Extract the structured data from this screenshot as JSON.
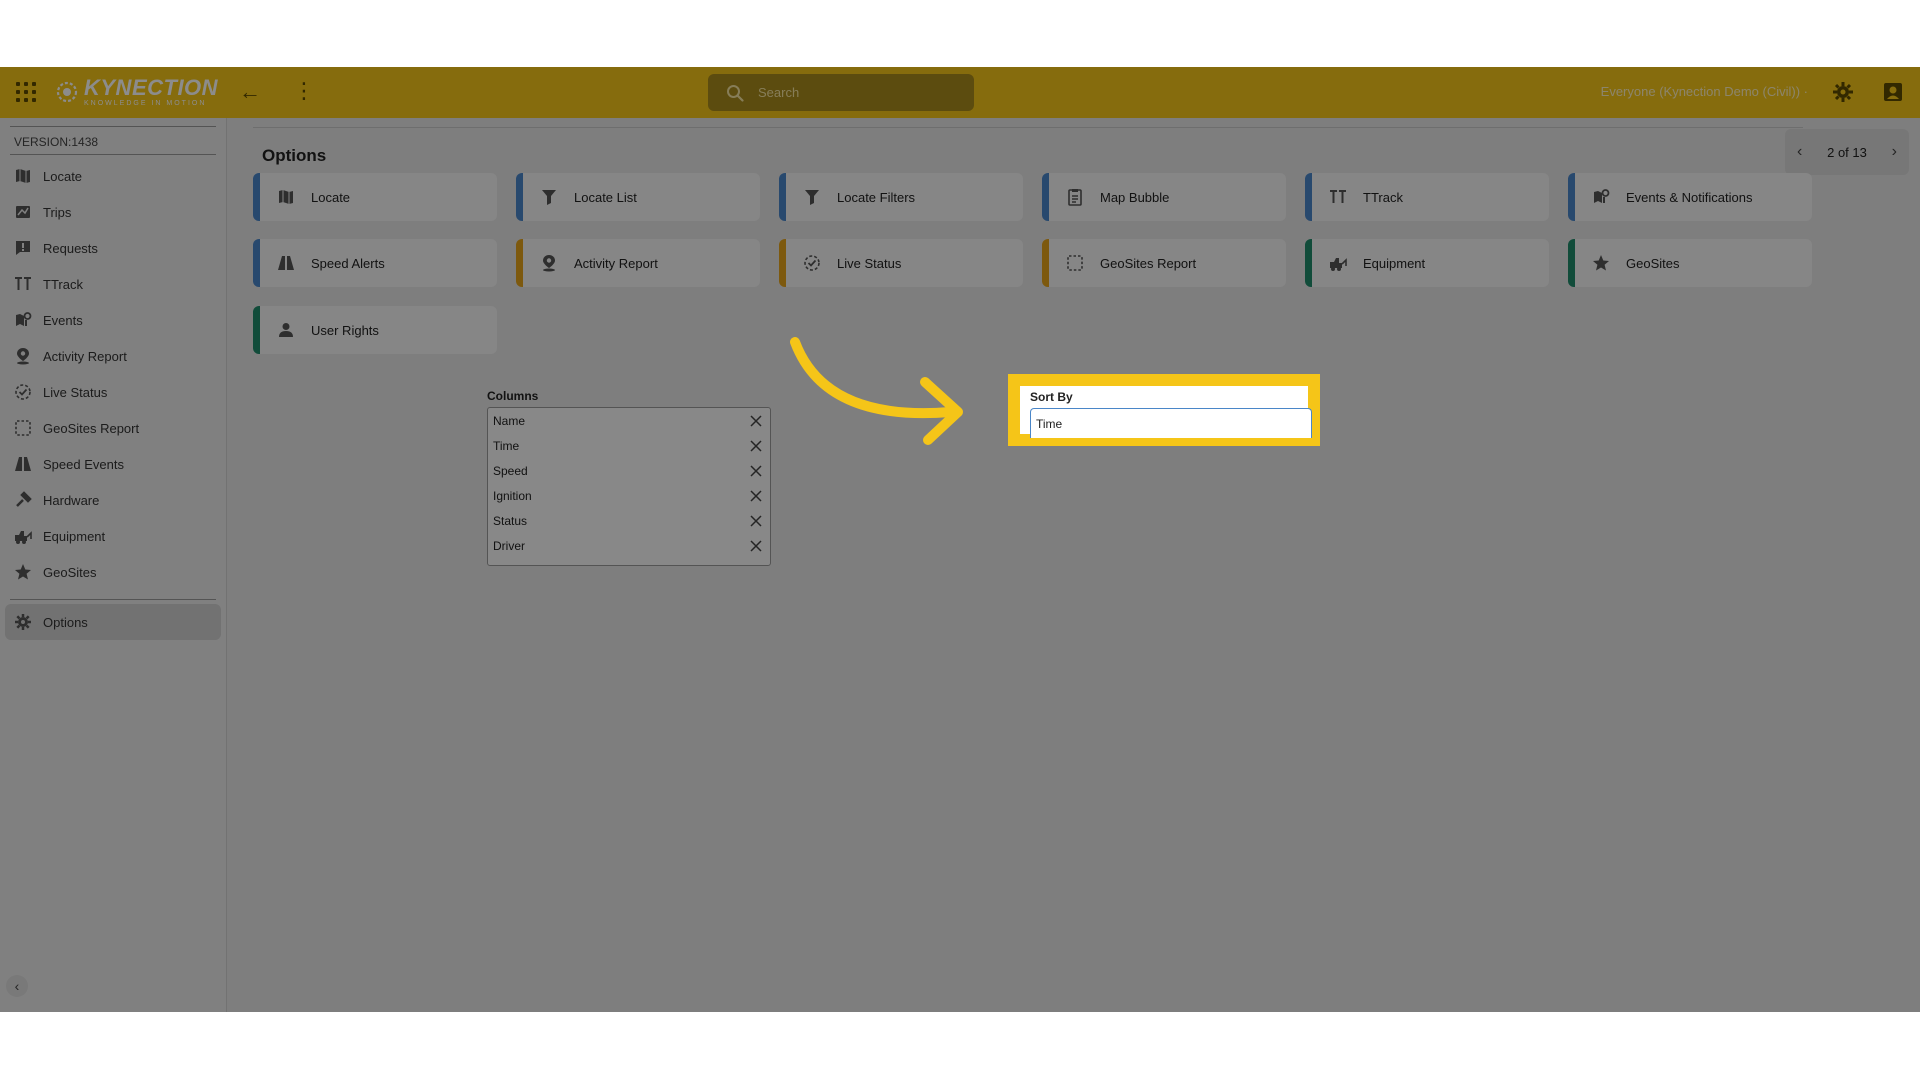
{
  "topbar": {
    "logo_name": "KYNECTION",
    "logo_tagline": "KNOWLEDGE IN MOTION",
    "search_placeholder": "Search",
    "account_label": "Everyone (Kynection Demo (Civil)) ·"
  },
  "sidebar": {
    "version": "VERSION:1438",
    "items": [
      {
        "label": "Locate",
        "icon": "map-icon"
      },
      {
        "label": "Trips",
        "icon": "trips-icon"
      },
      {
        "label": "Requests",
        "icon": "requests-icon"
      },
      {
        "label": "TTrack",
        "icon": "ttrack-icon"
      },
      {
        "label": "Events",
        "icon": "events-icon"
      },
      {
        "label": "Activity Report",
        "icon": "location-pin-icon"
      },
      {
        "label": "Live Status",
        "icon": "live-status-icon"
      },
      {
        "label": "GeoSites Report",
        "icon": "dashed-square-icon"
      },
      {
        "label": "Speed Events",
        "icon": "road-icon"
      },
      {
        "label": "Hardware",
        "icon": "hardware-icon"
      },
      {
        "label": "Equipment",
        "icon": "equipment-icon"
      },
      {
        "label": "GeoSites",
        "icon": "star-icon"
      }
    ],
    "options_label": "Options"
  },
  "main": {
    "title": "Options",
    "pager": "2 of 13",
    "tiles": [
      {
        "label": "Locate",
        "color": "#4a86c8"
      },
      {
        "label": "Locate List",
        "color": "#4a86c8"
      },
      {
        "label": "Locate Filters",
        "color": "#4a86c8"
      },
      {
        "label": "Map Bubble",
        "color": "#4a86c8"
      },
      {
        "label": "TTrack",
        "color": "#4a86c8"
      },
      {
        "label": "Events & Notifications",
        "color": "#4a86c8"
      },
      {
        "label": "Speed Alerts",
        "color": "#4a86c8"
      },
      {
        "label": "Activity Report",
        "color": "#e3a21a"
      },
      {
        "label": "Live Status",
        "color": "#e3a21a"
      },
      {
        "label": "GeoSites Report",
        "color": "#e3a21a"
      },
      {
        "label": "Equipment",
        "color": "#1f8a6b"
      },
      {
        "label": "GeoSites",
        "color": "#1f8a6b"
      },
      {
        "label": "User Rights",
        "color": "#1f8a6b"
      }
    ],
    "columns_label": "Columns",
    "columns": [
      "Name",
      "Time",
      "Speed",
      "Ignition",
      "Status",
      "Driver"
    ],
    "sort_by_label": "Sort By",
    "sort_by_value": "Time"
  },
  "colors": {
    "brand": "#f5c518",
    "accent_blue": "#4a86c8",
    "accent_orange": "#e3a21a",
    "accent_green": "#1f8a6b"
  }
}
